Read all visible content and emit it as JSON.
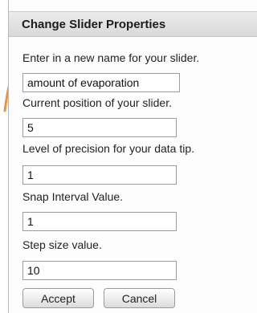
{
  "dialog": {
    "title": "Change Slider Properties",
    "fields": [
      {
        "label": "Enter in a new name for your slider.",
        "value": "amount of evaporation"
      },
      {
        "label": "Current position of your slider.",
        "value": "5"
      },
      {
        "label": "Level of precision for your data tip.",
        "value": "1"
      },
      {
        "label": "Snap Interval Value.",
        "value": "1"
      },
      {
        "label": "Step size value.",
        "value": "10"
      }
    ],
    "accept_label": "Accept",
    "cancel_label": "Cancel"
  },
  "colors": {
    "pointer": "#e8963a",
    "header_bg": "#e2e2e2"
  }
}
